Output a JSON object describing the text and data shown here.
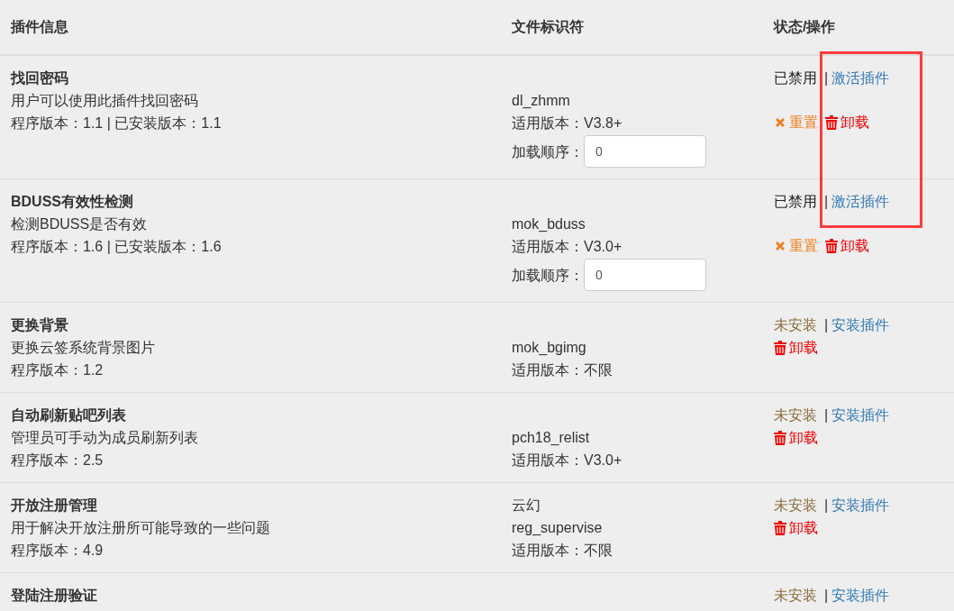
{
  "table": {
    "columns": [
      "插件信息",
      "文件标识符",
      "状态/操作"
    ],
    "rows": [
      {
        "name": "找回密码",
        "description": "用户可以使用此插件找回密码",
        "version": "程序版本：1.1 | 已安装版本：1.1",
        "file_id": "dl_zhmm",
        "compat": "适用版本：V3.8+",
        "load_order": {
          "label": "加载顺序：",
          "value": "0"
        },
        "status": {
          "kind": "disabled",
          "text": "已禁用",
          "separator": "|",
          "action": "激活插件"
        },
        "actions": [
          {
            "kind": "reset",
            "label": "重置"
          },
          {
            "kind": "uninstall",
            "label": "卸载"
          }
        ]
      },
      {
        "name": "BDUSS有效性检测",
        "description": "检测BDUSS是否有效",
        "version": "程序版本：1.6 | 已安装版本：1.6",
        "file_id": "mok_bduss",
        "compat": "适用版本：V3.0+",
        "load_order": {
          "label": "加载顺序：",
          "value": "0"
        },
        "status": {
          "kind": "disabled",
          "text": "已禁用",
          "separator": "|",
          "action": "激活插件"
        },
        "actions": [
          {
            "kind": "reset",
            "label": "重置"
          },
          {
            "kind": "uninstall",
            "label": "卸载"
          }
        ]
      },
      {
        "name": "更换背景",
        "description": "更换云签系统背景图片",
        "version": "程序版本：1.2",
        "file_id": "mok_bgimg",
        "compat": "适用版本：不限",
        "status": {
          "kind": "not_installed",
          "text": "未安装",
          "separator": "|",
          "action": "安装插件"
        },
        "actions": [
          {
            "kind": "uninstall",
            "label": "卸载"
          }
        ]
      },
      {
        "name": "自动刷新贴吧列表",
        "description": "管理员可手动为成员刷新列表",
        "version": "程序版本：2.5",
        "file_id": "pch18_relist",
        "compat": "适用版本：V3.0+",
        "status": {
          "kind": "not_installed",
          "text": "未安装",
          "separator": "|",
          "action": "安装插件"
        },
        "actions": [
          {
            "kind": "uninstall",
            "label": "卸载"
          }
        ]
      },
      {
        "name": "开放注册管理",
        "description": "用于解决开放注册所可能导致的一些问题",
        "version": "程序版本：4.9",
        "author": "云幻",
        "file_id": "reg_supervise",
        "compat": "适用版本：不限",
        "status": {
          "kind": "not_installed",
          "text": "未安装",
          "separator": "|",
          "action": "安装插件"
        },
        "actions": [
          {
            "kind": "uninstall",
            "label": "卸载"
          }
        ]
      },
      {
        "name": "登陆注册验证",
        "status": {
          "kind": "not_installed",
          "text": "未安装",
          "separator": "|",
          "action": "安装插件"
        }
      }
    ]
  }
}
